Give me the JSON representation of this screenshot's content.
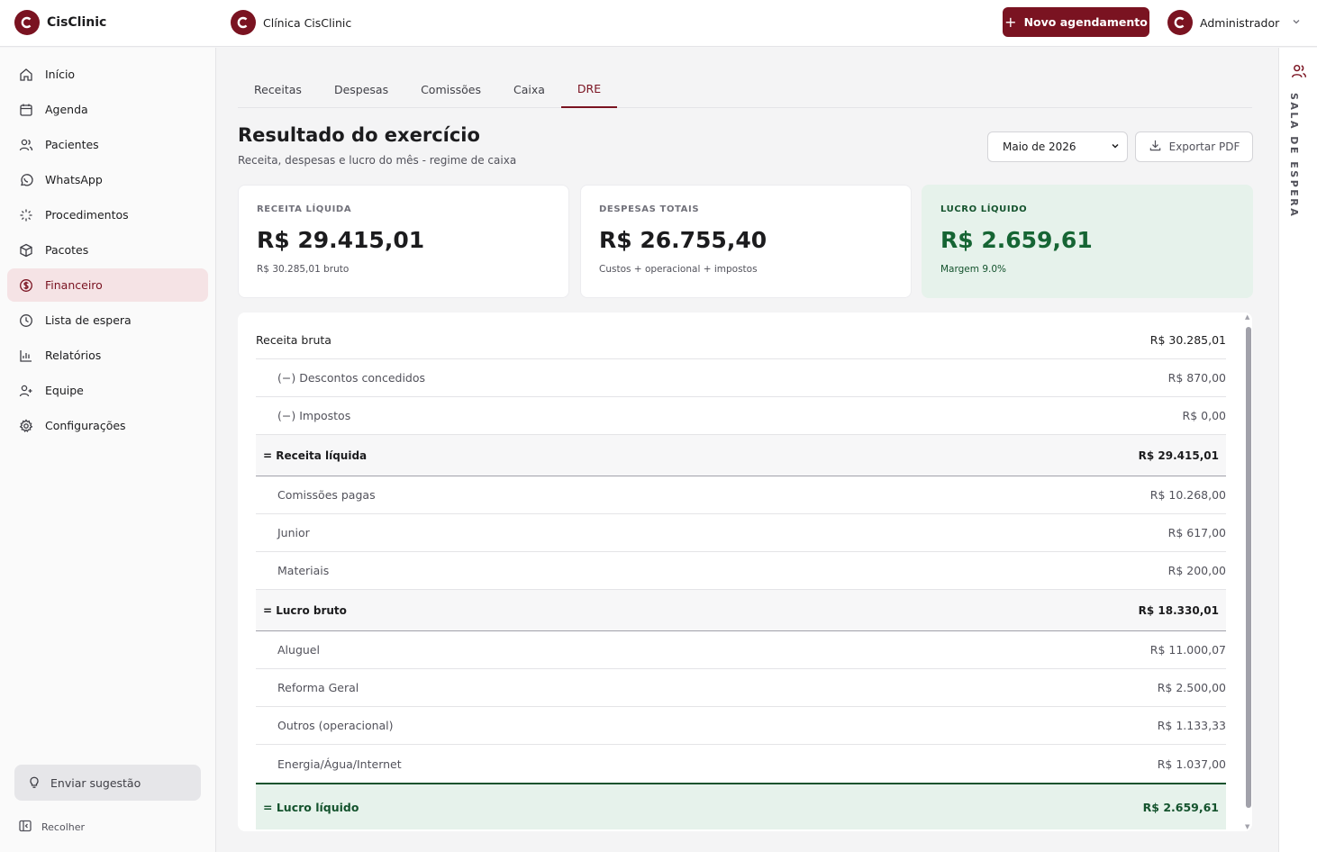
{
  "app": {
    "name": "CisClinic",
    "clinic_name": "Clínica CisClinic"
  },
  "header": {
    "new_button": "Novo agendamento",
    "user_name": "Administrador"
  },
  "sidebar": {
    "items": [
      {
        "label": "Início",
        "icon": "home-icon"
      },
      {
        "label": "Agenda",
        "icon": "calendar-icon"
      },
      {
        "label": "Pacientes",
        "icon": "users-icon"
      },
      {
        "label": "WhatsApp",
        "icon": "whatsapp-icon"
      },
      {
        "label": "Procedimentos",
        "icon": "sparkle-icon"
      },
      {
        "label": "Pacotes",
        "icon": "package-icon"
      },
      {
        "label": "Financeiro",
        "icon": "dollar-icon",
        "active": true
      },
      {
        "label": "Lista de espera",
        "icon": "clock-icon"
      },
      {
        "label": "Relatórios",
        "icon": "bar-chart-icon"
      },
      {
        "label": "Equipe",
        "icon": "user-plus-icon"
      },
      {
        "label": "Configurações",
        "icon": "gear-icon"
      }
    ],
    "suggest_label": "Enviar sugestão",
    "collapse_label": "Recolher"
  },
  "right_rail": {
    "label": "SALA DE ESPERA"
  },
  "tabs": [
    "Receitas",
    "Despesas",
    "Comissões",
    "Caixa",
    "DRE"
  ],
  "active_tab": "DRE",
  "page": {
    "title": "Resultado do exercício",
    "subtitle": "Receita, despesas e lucro do mês - regime de caixa",
    "period": "Maio de 2026",
    "export_label": "Exportar PDF"
  },
  "cards": [
    {
      "label": "RECEITA LÍQUIDA",
      "value": "R$ 29.415,01",
      "note": "R$ 30.285,01 bruto"
    },
    {
      "label": "DESPESAS TOTAIS",
      "value": "R$ 26.755,40",
      "note": "Custos + operacional + impostos"
    },
    {
      "label": "LUCRO LÍQUIDO",
      "value": "R$ 2.659,61",
      "note": "Margem 9.0%"
    }
  ],
  "dre": [
    {
      "label": "Receita bruta",
      "value": "R$ 30.285,01",
      "type": "head"
    },
    {
      "label": "(−) Descontos concedidos",
      "value": "R$ 870,00",
      "type": "item"
    },
    {
      "label": "(−) Impostos",
      "value": "R$ 0,00",
      "type": "item"
    },
    {
      "label": "= Receita líquida",
      "value": "R$ 29.415,01",
      "type": "sub"
    },
    {
      "label": "Comissões pagas",
      "value": "R$ 10.268,00",
      "type": "item"
    },
    {
      "label": "Junior",
      "value": "R$ 617,00",
      "type": "item"
    },
    {
      "label": "Materiais",
      "value": "R$ 200,00",
      "type": "item"
    },
    {
      "label": "= Lucro bruto",
      "value": "R$ 18.330,01",
      "type": "sub"
    },
    {
      "label": "Aluguel",
      "value": "R$ 11.000,07",
      "type": "item"
    },
    {
      "label": "Reforma Geral",
      "value": "R$ 2.500,00",
      "type": "item"
    },
    {
      "label": "Outros (operacional)",
      "value": "R$ 1.133,33",
      "type": "item"
    },
    {
      "label": "Energia/Água/Internet",
      "value": "R$ 1.037,00",
      "type": "item"
    },
    {
      "label": "= Lucro líquido",
      "value": "R$ 2.659,61",
      "type": "final"
    }
  ],
  "colors": {
    "brand": "#7a1321",
    "profit_bg": "#e6f2eb",
    "profit_text": "#166534"
  }
}
